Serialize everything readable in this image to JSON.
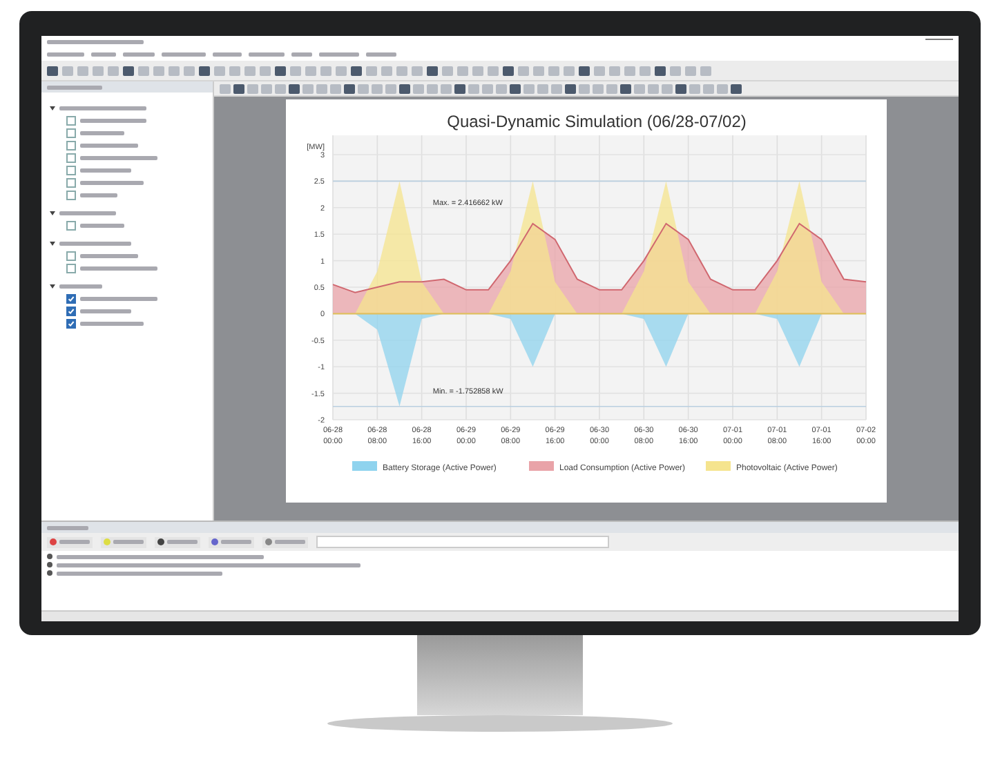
{
  "tree": [
    {
      "expanded": true,
      "children": [
        {
          "checked": false
        },
        {
          "checked": false
        },
        {
          "checked": false
        },
        {
          "checked": false
        },
        {
          "checked": false
        },
        {
          "checked": false
        },
        {
          "checked": false
        }
      ]
    },
    {
      "expanded": true,
      "children": [
        {
          "checked": false
        }
      ]
    },
    {
      "expanded": true,
      "children": [
        {
          "checked": false
        },
        {
          "checked": false
        }
      ]
    },
    {
      "expanded": true,
      "children": [
        {
          "checked": true
        },
        {
          "checked": true
        },
        {
          "checked": true
        }
      ]
    }
  ],
  "plot": {
    "chart_data": {
      "type": "area",
      "title": "Quasi-Dynamic Simulation (06/28-07/02)",
      "ylabel": "[MW]",
      "categories": [
        "06-28 00:00",
        null,
        "06-28 08:00",
        null,
        "06-28 16:00",
        null,
        "06-29 00:00",
        null,
        "06-29 08:00",
        null,
        "06-29 16:00",
        null,
        "06-30 00:00",
        null,
        "06-30 08:00",
        null,
        "06-30 16:00",
        null,
        "07-01 00:00",
        null,
        "07-01 08:00",
        null,
        "07-01 16:00",
        null,
        "07-02 00:00"
      ],
      "ylim": [
        -2,
        3
      ],
      "yticks": [
        3,
        2.5,
        2,
        1.5,
        1,
        0.5,
        0,
        -0.5,
        -1,
        -1.5,
        -2
      ],
      "series": [
        {
          "name": "Battery Storage (Active Power)",
          "color": "#8fd3ee",
          "values": [
            0,
            0,
            -0.3,
            -1.75,
            -0.1,
            0,
            0,
            0,
            -0.1,
            -1,
            0,
            0,
            0,
            0,
            -0.1,
            -1,
            0,
            0,
            0,
            0,
            -0.1,
            -1,
            0,
            0,
            0
          ]
        },
        {
          "name": "Load Consumption (Active Power)",
          "color": "#e9a3a8",
          "values": [
            0.55,
            0.4,
            0.5,
            0.6,
            0.6,
            0.65,
            0.45,
            0.45,
            1.0,
            1.7,
            1.4,
            0.65,
            0.45,
            0.45,
            1.0,
            1.7,
            1.4,
            0.65,
            0.45,
            0.45,
            1.0,
            1.7,
            1.4,
            0.65,
            0.6
          ]
        },
        {
          "name": "Photovoltaic (Active Power)",
          "color": "#f5e48e",
          "values": [
            0,
            0,
            0.8,
            2.5,
            0.6,
            0,
            0,
            0,
            0.8,
            2.5,
            0.6,
            0,
            0,
            0,
            0.8,
            2.5,
            0.6,
            0,
            0,
            0,
            0.8,
            2.5,
            0.6,
            0,
            0
          ]
        }
      ],
      "grid": true,
      "legend": "bottom",
      "ref_lines": [
        {
          "axis": "y",
          "value": 2.5,
          "color": "#b9cfe0"
        },
        {
          "axis": "y",
          "value": -1.75,
          "color": "#b9cfe0"
        }
      ],
      "annotations": [
        "Max. = 2.416662 kW",
        "Min. = -1.752858 kW"
      ]
    }
  }
}
